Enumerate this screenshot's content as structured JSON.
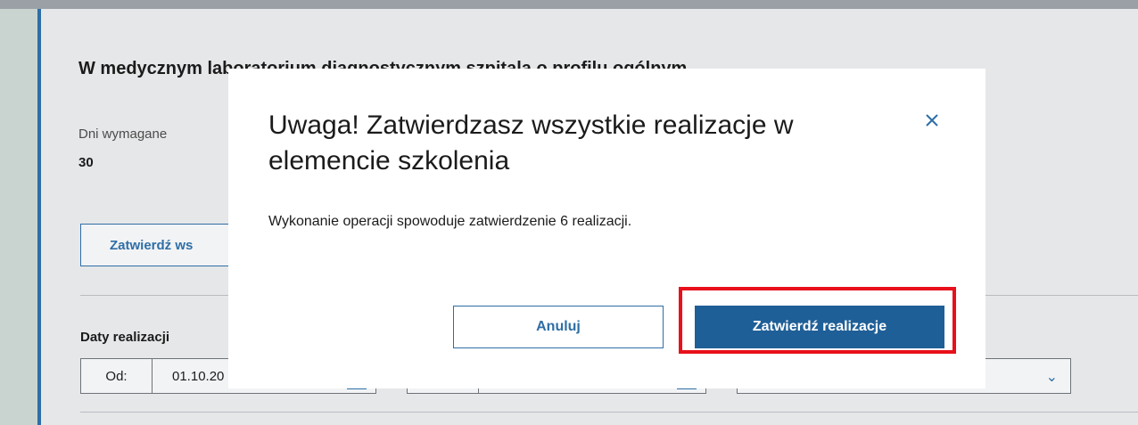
{
  "background": {
    "section_title": "W medycznym laboratorium diagnostycznym szpitala o profilu ogólnym",
    "days_required_label": "Dni wymagane",
    "days_required_value": "30",
    "approve_all_button": "Zatwierdź ws",
    "dates_label": "Daty realizacji",
    "date_from_prefix": "Od:",
    "date_from_value": "01.10.20"
  },
  "modal": {
    "title": "Uwaga! Zatwierdzasz wszystkie realizacje w elemencie szkolenia",
    "body": "Wykonanie operacji spowoduje zatwierdzenie 6 realizacji.",
    "cancel_label": "Anuluj",
    "confirm_label": "Zatwierdź realizacje",
    "close_icon": "close-icon",
    "highlight_color": "#e8101a",
    "accent_color": "#1f5f97"
  }
}
